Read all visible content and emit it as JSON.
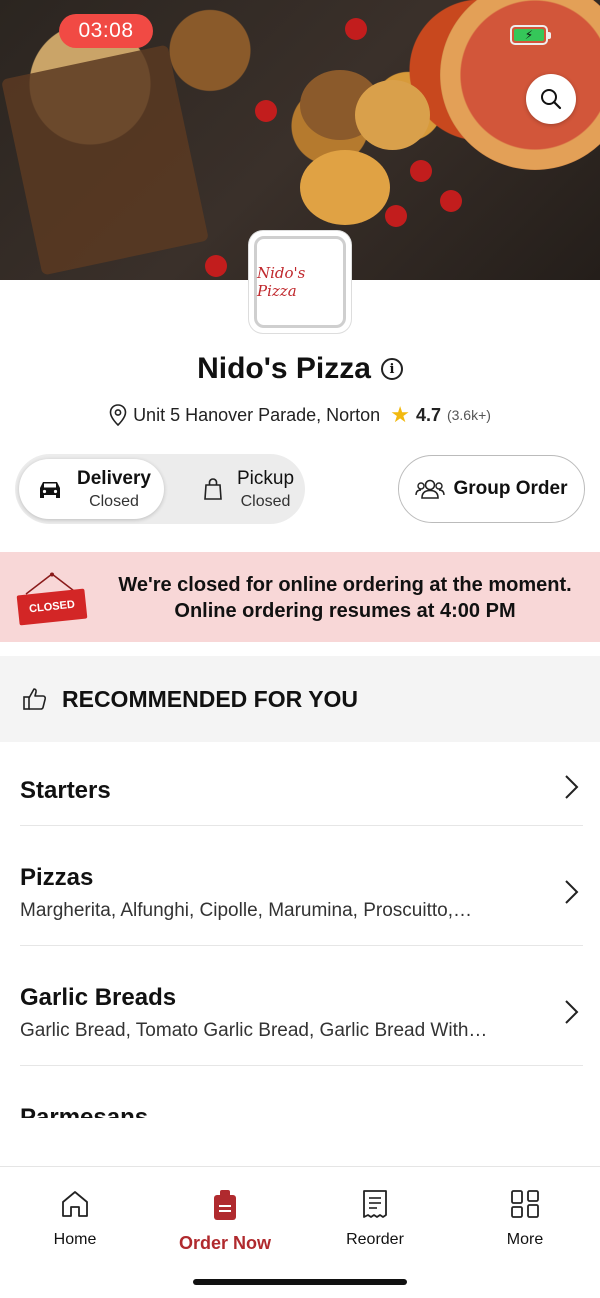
{
  "status": {
    "time": "03:08"
  },
  "restaurant": {
    "logo_text": "Nido's Pizza",
    "name": "Nido's Pizza",
    "address": "Unit 5 Hanover Parade, Norton",
    "rating": "4.7",
    "rating_count": "(3.6k+)"
  },
  "modes": {
    "delivery": {
      "label": "Delivery",
      "status": "Closed"
    },
    "pickup": {
      "label": "Pickup",
      "status": "Closed"
    },
    "group_order": "Group Order"
  },
  "banner": {
    "sign": "CLOSED",
    "line1": "We're closed for online ordering at the moment.",
    "line2": "Online ordering resumes at 4:00 PM"
  },
  "recommended": {
    "label": "RECOMMENDED FOR YOU"
  },
  "categories": [
    {
      "title": "Starters",
      "subtitle": ""
    },
    {
      "title": "Pizzas",
      "subtitle": "Margherita, Alfunghi, Cipolle, Marumina, Proscuitto,…"
    },
    {
      "title": "Garlic Breads",
      "subtitle": "Garlic Bread, Tomato Garlic Bread, Garlic Bread With…"
    },
    {
      "title": "Parmesans",
      "subtitle": ""
    }
  ],
  "nav": {
    "items": [
      {
        "label": "Home",
        "icon": "home-icon"
      },
      {
        "label": "Order Now",
        "icon": "order-bag-icon"
      },
      {
        "label": "Reorder",
        "icon": "receipt-icon"
      },
      {
        "label": "More",
        "icon": "grid-icon"
      }
    ]
  },
  "colors": {
    "accent": "#b02a2e",
    "banner_bg": "#f8d7d7",
    "timer": "#f14a44",
    "star": "#f2b90f"
  }
}
